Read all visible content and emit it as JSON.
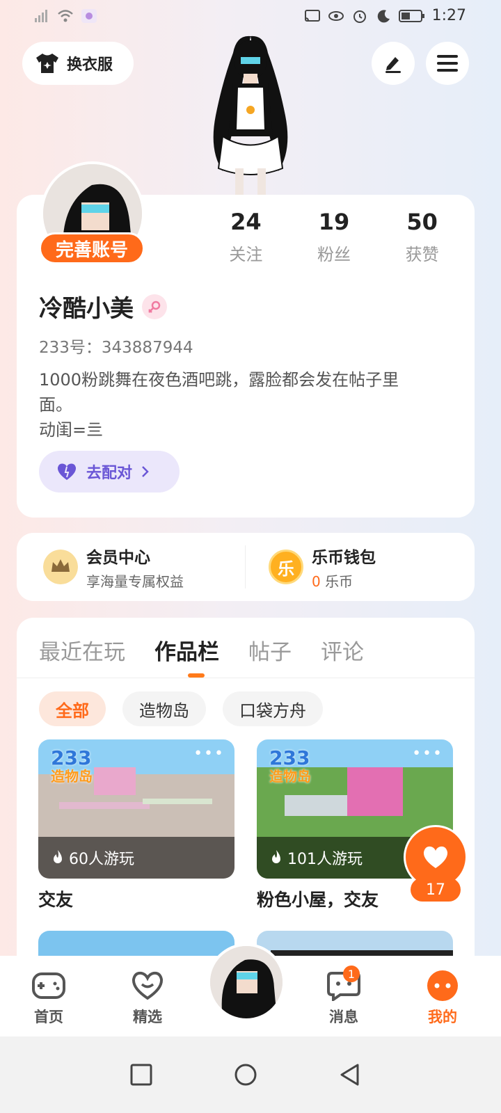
{
  "status_bar": {
    "time": "1:27"
  },
  "header": {
    "outfit_label": "换衣服"
  },
  "profile": {
    "complete_badge": "完善账号",
    "stats": [
      {
        "value": "24",
        "label": "关注"
      },
      {
        "value": "19",
        "label": "粉丝"
      },
      {
        "value": "50",
        "label": "获赞"
      }
    ],
    "nickname": "冷酷小美",
    "uid": "233号：343887944",
    "bio_line1": "1000粉跳舞在夜色酒吧跳，露脸都会发在帖子里",
    "bio_line2": "面。",
    "bio_line3": "动闺=亖",
    "match_label": "去配对"
  },
  "member_center": {
    "title": "会员中心",
    "subtitle": "享海量专属权益"
  },
  "wallet": {
    "title": "乐币钱包",
    "amount": "0",
    "unit": "乐币",
    "icon_text": "乐"
  },
  "tabs": [
    {
      "label": "最近在玩"
    },
    {
      "label": "作品栏"
    },
    {
      "label": "帖子"
    },
    {
      "label": "评论"
    }
  ],
  "chips": [
    {
      "label": "全部"
    },
    {
      "label": "造物岛"
    },
    {
      "label": "口袋方舟"
    }
  ],
  "works": [
    {
      "plays": "60人游玩",
      "title": "交友",
      "logo": "233",
      "logo_sub": "造物岛"
    },
    {
      "plays": "101人游玩",
      "title": "粉色小屋，交友",
      "logo": "233",
      "logo_sub": "造物岛"
    }
  ],
  "likes": {
    "count": "17"
  },
  "bottom_nav": [
    {
      "label": "首页"
    },
    {
      "label": "精选"
    },
    {
      "label": "消息",
      "badge": "1"
    },
    {
      "label": "我的"
    }
  ],
  "colors": {
    "accent": "#ff6a1a",
    "match_purple": "#6a56d6"
  }
}
